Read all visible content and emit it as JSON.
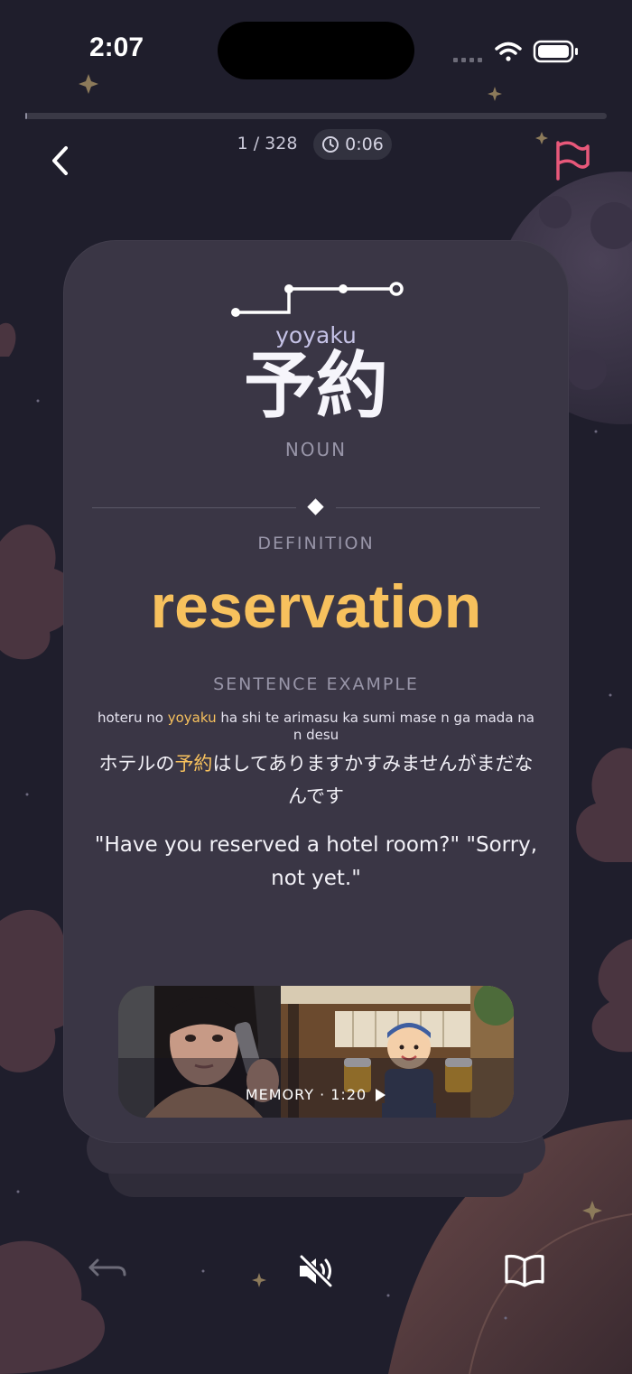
{
  "status_bar": {
    "time": "2:07"
  },
  "progress": {
    "fraction": 0.003
  },
  "header": {
    "counter": "1 / 328",
    "timer": "0:06"
  },
  "icons": {
    "back": "chevron-left-icon",
    "flag": "flag-icon",
    "clock": "clock-icon",
    "undo": "undo-arrow-icon",
    "mute": "speaker-muted-icon",
    "book": "open-book-icon",
    "play": "play-icon"
  },
  "card": {
    "reading": "yoyaku",
    "word": "予約",
    "part_of_speech": "NOUN",
    "definition_label": "DEFINITION",
    "definition": "reservation",
    "example_label": "SENTENCE EXAMPLE",
    "romaji": {
      "before": "hoteru no ",
      "highlight": "yoyaku",
      "after": " ha shi te arimasu ka sumi mase n ga mada na n desu"
    },
    "japanese": {
      "before": "ホテルの",
      "highlight": "予約",
      "after": "はしてありますかすみませんがまだなんです"
    },
    "english": "\"Have you reserved a hotel room?\" \"Sorry, not yet.\"",
    "memory": {
      "label": "MEMORY · 1:20"
    }
  },
  "colors": {
    "background": "#1f1e2c",
    "card": "#3a3645",
    "accent": "#f7c15d",
    "flag": "#e8587a",
    "muted_text": "#9895a8"
  }
}
